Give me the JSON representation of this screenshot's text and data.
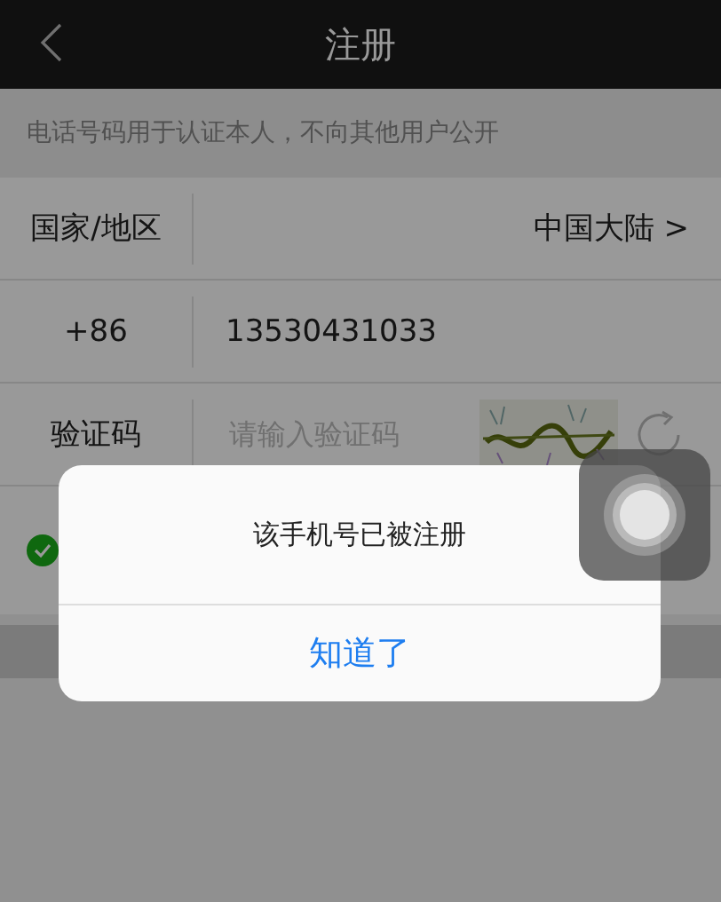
{
  "header": {
    "title": "注册"
  },
  "notice": "电话号码用于认证本人，不向其他用户公开",
  "form": {
    "country": {
      "label": "国家/地区",
      "value": "中国大陆 >"
    },
    "phone": {
      "code": "+86",
      "value": "13530431033"
    },
    "captcha": {
      "label": "验证码",
      "placeholder": "请输入验证码"
    }
  },
  "agreement": {
    "checked": true
  },
  "dialog": {
    "message": "该手机号已被注册",
    "button": "知道了"
  }
}
